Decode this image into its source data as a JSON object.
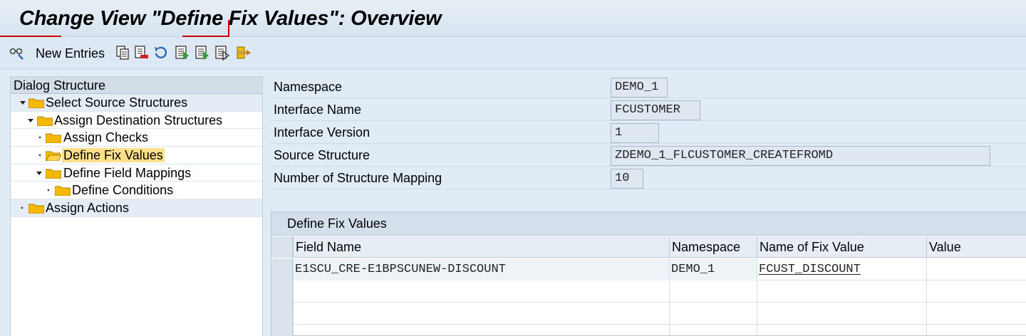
{
  "window": {
    "title": "Change View \"Define Fix Values\": Overview"
  },
  "toolbar": {
    "new_entries_label": "New Entries",
    "icons": [
      "display-change-icon",
      "copy-icon",
      "delete-icon",
      "undo-icon",
      "select-all-icon",
      "select-block-icon",
      "deselect-all-icon",
      "transport-icon"
    ]
  },
  "dialog": {
    "header": "Dialog Structure",
    "items": [
      {
        "label": "Select Source Structures"
      },
      {
        "label": "Assign Destination Structures"
      },
      {
        "label": "Assign Checks"
      },
      {
        "label": "Define Fix Values"
      },
      {
        "label": "Define Field Mappings"
      },
      {
        "label": "Define Conditions"
      },
      {
        "label": "Assign Actions"
      }
    ]
  },
  "fields": [
    {
      "label": "Namespace",
      "value": "DEMO_1"
    },
    {
      "label": "Interface Name",
      "value": "FCUSTOMER"
    },
    {
      "label": "Interface Version",
      "value": "1"
    },
    {
      "label": "Source Structure",
      "value": "ZDEMO_1_FLCUSTOMER_CREATEFROMD"
    },
    {
      "label": "Number of Structure Mapping",
      "value": "10"
    }
  ],
  "table": {
    "title": "Define Fix Values",
    "columns": [
      "Field Name",
      "Namespace",
      "Name of Fix Value",
      "Value"
    ],
    "rows": [
      {
        "field_name": "E1SCU_CRE-E1BPSCUNEW-DISCOUNT",
        "namespace": "DEMO_1",
        "fix_value": "FCUST_DISCOUNT",
        "value": ""
      }
    ]
  },
  "colors": {
    "selected": "#ffe08a",
    "folder": "#f5b800",
    "accent_red": "#cc0000"
  }
}
